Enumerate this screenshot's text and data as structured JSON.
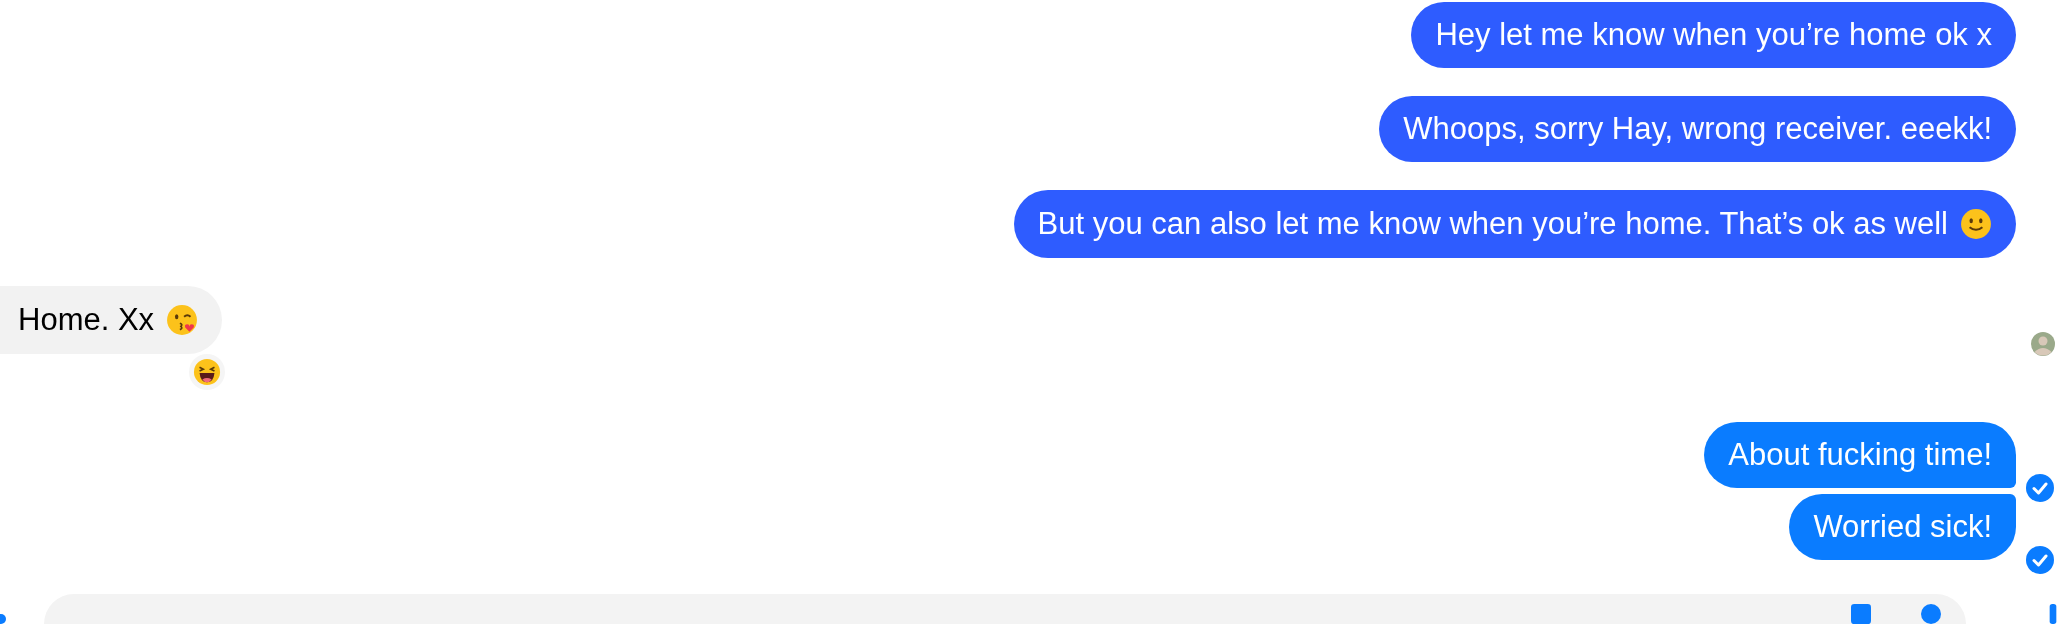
{
  "messages": [
    {
      "kind": "outgoing",
      "text": "Hey let me know when you’re home ok x",
      "color": "#2e5cff",
      "grouped_with_previous": false,
      "delivered": false
    },
    {
      "kind": "outgoing",
      "text": "Whoops, sorry Hay, wrong receiver. eeekk!",
      "color": "#2e5cff",
      "grouped_with_previous": false,
      "delivered": false
    },
    {
      "kind": "outgoing",
      "text": "But you can also let me know when you’re home. That’s ok as well",
      "emoji": {
        "kind": "smile"
      },
      "color": "#2e5cff",
      "grouped_with_previous": false,
      "delivered": false
    },
    {
      "kind": "incoming",
      "text": "Home. Xx",
      "emoji": {
        "kind": "kiss"
      },
      "reaction": {
        "kind": "laugh"
      },
      "seen_marker": true
    },
    {
      "kind": "outgoing",
      "text": "About fucking time!",
      "color": "#0a7cff",
      "grouped_with_previous": false,
      "delivered": true
    },
    {
      "kind": "outgoing",
      "text": "Worried sick!",
      "color": "#0a7cff",
      "grouped_with_previous": true,
      "delivered": true
    }
  ],
  "composer": {
    "kind": "text"
  }
}
